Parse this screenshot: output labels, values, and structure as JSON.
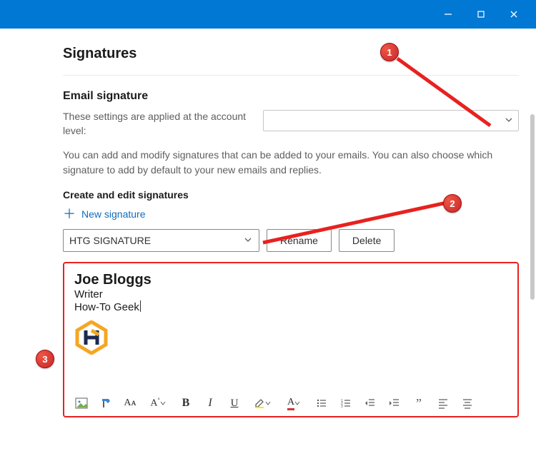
{
  "titlebar": {
    "minimize_title": "Minimize",
    "maximize_title": "Maximize",
    "close_title": "Close"
  },
  "page": {
    "title": "Signatures",
    "section_title": "Email signature",
    "account_level_label": "These settings are applied at the account level:",
    "account_selected": "",
    "description": "You can add and modify signatures that can be added to your emails. You can also choose which signature to add by default to your new emails and replies.",
    "create_edit_title": "Create and edit signatures",
    "new_signature_label": "New signature",
    "signature_selected": "HTG SIGNATURE",
    "rename_label": "Rename",
    "delete_label": "Delete"
  },
  "signature_content": {
    "name": "Joe Bloggs",
    "title": "Writer",
    "company": "How-To Geek",
    "logo_alt": "HTG logo"
  },
  "toolbar": {
    "image": "Insert image",
    "paint": "Paint format",
    "fontcase": "Change case",
    "fontsize": "Font size",
    "bold": "B",
    "italic": "I",
    "underline": "U",
    "highlight": "Highlight",
    "fontcolor": "Font color",
    "bullets": "Bulleted list",
    "numbers": "Numbered list",
    "outdent": "Decrease indent",
    "indent": "Increase indent",
    "quote": "Quote",
    "align_left": "Align left",
    "align_center": "Align center"
  },
  "annotations": {
    "b1": "1",
    "b2": "2",
    "b3": "3"
  },
  "colors": {
    "accent": "#0f6cbd",
    "titlebar": "#0078d4",
    "annotation_red": "#e8211f"
  }
}
